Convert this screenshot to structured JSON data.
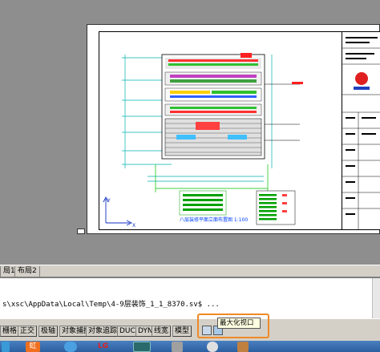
{
  "tabs": [
    {
      "label": "局1"
    },
    {
      "label": "布局2"
    }
  ],
  "command": {
    "text": "s\\xsc\\AppData\\Local\\Temp\\4-9层装饰_1_1_8370.sv$ ..."
  },
  "status_buttons": [
    {
      "label": "栅格"
    },
    {
      "label": "正交"
    },
    {
      "label": "极轴"
    },
    {
      "label": "对象捕捉"
    },
    {
      "label": "对象追踪"
    },
    {
      "label": "DUCS"
    },
    {
      "label": "DYN"
    },
    {
      "label": "线宽"
    },
    {
      "label": "模型"
    }
  ],
  "tooltip": {
    "text": "最大化视口"
  },
  "drawing": {
    "caption": "八层装修平面立面布置图 1:100",
    "ucs_x": "X",
    "ucs_y": "Y"
  },
  "taskbar": {
    "items": [
      {
        "label": "虹"
      },
      {
        "label": "LG"
      }
    ]
  },
  "colors": {
    "highlight": "#f08a24",
    "tooltip_bg": "#ffffe1",
    "paper": "#ffffff",
    "model_bg": "#8e8e8e"
  }
}
